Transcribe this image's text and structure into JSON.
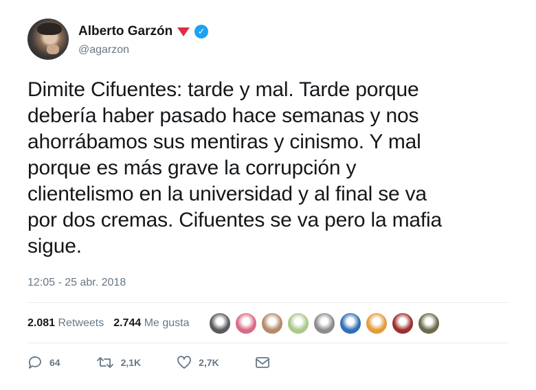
{
  "user": {
    "name": "Alberto Garzón",
    "handle": "@agarzon"
  },
  "tweet": {
    "text": "Dimite Cifuentes: tarde y mal. Tarde porque\ndebería haber pasado hace semanas y nos\nahorrábamos sus mentiras y cinismo. Y mal\nporque es más grave la corrupción y\nclientelismo en la universidad y al final se va\npor dos cremas. Cifuentes se va pero la mafia\nsigue.",
    "timestamp": "12:05 - 25 abr. 2018"
  },
  "stats": {
    "retweets_count": "2.081",
    "retweets_label": "Retweets",
    "likes_count": "2.744",
    "likes_label": "Me gusta"
  },
  "actions": {
    "replies": "64",
    "retweets": "2,1K",
    "likes": "2,7K"
  },
  "liker_avatars": [
    "#5a5a5a",
    "#d86a86",
    "#b38a6a",
    "#a9c98a",
    "#8c8c8c",
    "#2f6fb5",
    "#e39b3a",
    "#9c2f2f",
    "#6b6a4a"
  ],
  "colors": {
    "verified": "#1da1f2",
    "secondary_text": "#657786",
    "divider": "#e6ecf0",
    "emoji_triangle": "#dd2e44"
  }
}
